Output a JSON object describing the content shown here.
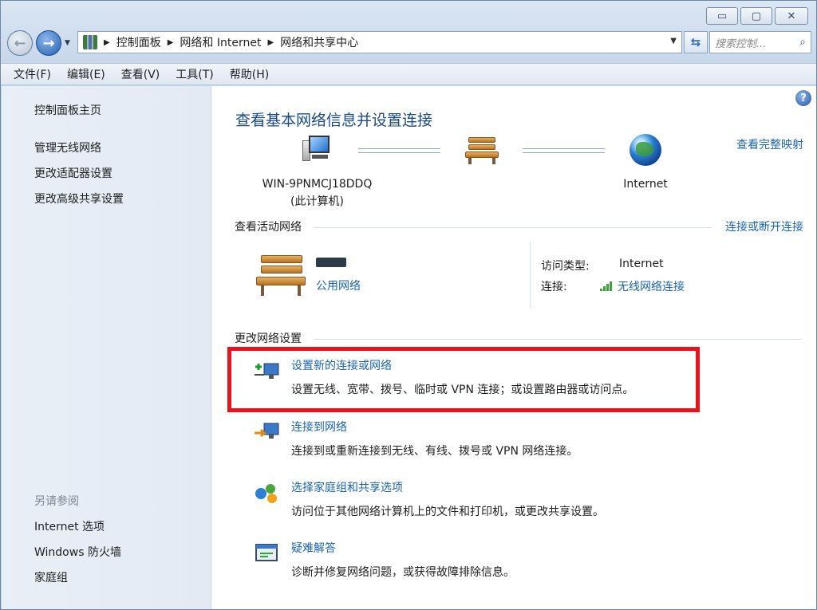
{
  "window": {
    "caption_buttons": {
      "minimize": "▭",
      "maximize": "▢",
      "close": "✕"
    }
  },
  "address": {
    "crumbs": [
      "控制面板",
      "网络和 Internet",
      "网络和共享中心"
    ],
    "search_placeholder": "搜索控制...",
    "icons": {
      "back": "back-arrow-icon",
      "forward": "forward-arrow-icon",
      "refresh": "refresh-icon",
      "search": "search-icon"
    }
  },
  "menu": [
    "文件(F)",
    "编辑(E)",
    "查看(V)",
    "工具(T)",
    "帮助(H)"
  ],
  "sidebar": {
    "home": "控制面板主页",
    "tasks": [
      "管理无线网络",
      "更改适配器设置",
      "更改高级共享设置"
    ],
    "see_also_title": "另请参阅",
    "see_also": [
      "Internet 选项",
      "Windows 防火墙",
      "家庭组"
    ]
  },
  "main": {
    "help": "?",
    "title": "查看基本网络信息并设置连接",
    "full_map_link": "查看完整映射",
    "computer_name": "WIN-9PNMCJ18DDQ",
    "computer_sub": "(此计算机)",
    "internet_label": "Internet",
    "active_networks_title": "查看活动网络",
    "connect_disconnect_link": "连接或断开连接",
    "network_type": "公用网络",
    "access_type_label": "访问类型:",
    "access_type_value": "Internet",
    "connection_label": "连接:",
    "connection_value": "无线网络连接",
    "change_settings_title": "更改网络设置",
    "tasks": [
      {
        "link": "设置新的连接或网络",
        "desc": "设置无线、宽带、拨号、临时或 VPN 连接；或设置路由器或访问点。"
      },
      {
        "link": "连接到网络",
        "desc": "连接到或重新连接到无线、有线、拨号或 VPN 网络连接。"
      },
      {
        "link": "选择家庭组和共享选项",
        "desc": "访问位于其他网络计算机上的文件和打印机，或更改共享设置。"
      },
      {
        "link": "疑难解答",
        "desc": "诊断并修复网络问题，或获得故障排除信息。"
      }
    ]
  },
  "colors": {
    "link": "#1a64b0",
    "title": "#1a4a8a",
    "highlight": "#e8141b"
  }
}
